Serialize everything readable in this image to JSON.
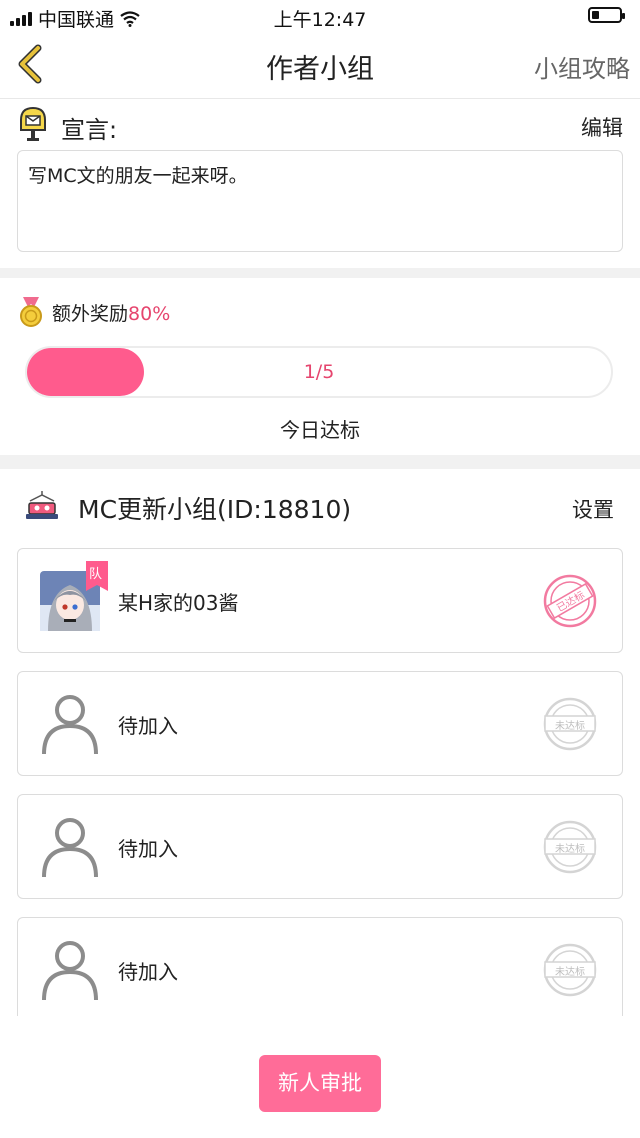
{
  "status_bar": {
    "carrier": "中国联通",
    "time": "上午12:47",
    "battery_level": 0.25
  },
  "nav": {
    "title": "作者小组",
    "right_action": "小组攻略",
    "back_icon": "chevron-left-icon"
  },
  "declaration": {
    "title": "宣言:",
    "edit_label": "编辑",
    "text": "写MC文的朋友一起来呀。"
  },
  "reward": {
    "label": "额外奖励",
    "percent": "80%"
  },
  "progress": {
    "text": "1/5",
    "value": 0.2,
    "status": "今日达标"
  },
  "group": {
    "title": "MC更新小组(ID:18810)",
    "settings_label": "设置"
  },
  "members": [
    {
      "name": "某H家的03酱",
      "badge": "队",
      "stamp": "已达标",
      "reached": true
    },
    {
      "name": "待加入",
      "stamp": "未达标",
      "reached": false
    },
    {
      "name": "待加入",
      "stamp": "未达标",
      "reached": false
    },
    {
      "name": "待加入",
      "stamp": "未达标",
      "reached": false
    }
  ],
  "approve_button": "新人审批",
  "colors": {
    "accent": "#ff5b8d",
    "accent_text": "#e6456e",
    "button": "#ff6c98",
    "back_arrow": "#d9b52c"
  }
}
